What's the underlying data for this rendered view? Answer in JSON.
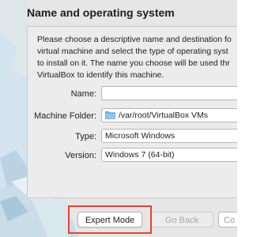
{
  "dialog": {
    "title": "Name and operating system",
    "description": "Please choose a descriptive name and destination fo\nvirtual machine and select the type of operating syst\nto install on it. The name you choose will be used thr\nVirtualBox to identify this machine."
  },
  "form": {
    "name_label": "Name:",
    "name_value": "",
    "folder_label": "Machine Folder:",
    "folder_value": "/var/root/VirtualBox VMs",
    "type_label": "Type:",
    "type_value": "Microsoft Windows",
    "version_label": "Version:",
    "version_value": "Windows 7 (64-bit)"
  },
  "buttons": {
    "expert_mode": "Expert Mode",
    "go_back": "Go Back",
    "continue": "Co"
  },
  "colors": {
    "highlight": "#e8432f",
    "background_art": "#cfe3ef"
  },
  "icons": {
    "folder": "folder-icon"
  }
}
